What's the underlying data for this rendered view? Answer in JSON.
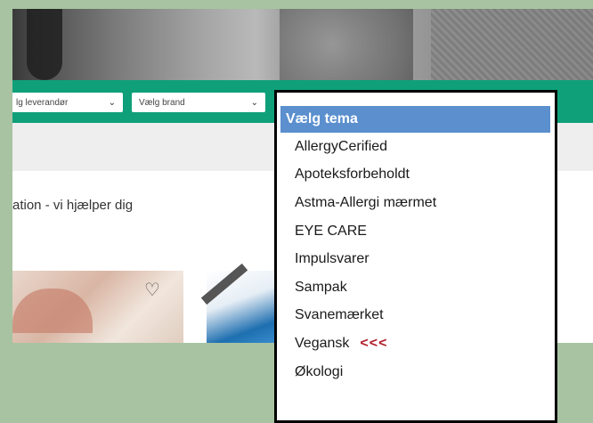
{
  "filters": {
    "supplier_label": "lg leverandør",
    "brand_label": "Vælg brand"
  },
  "main": {
    "headline": "ation - vi hjælper dig"
  },
  "dropdown": {
    "header": "Vælg tema",
    "items": [
      "AllergyCerified",
      "Apoteksforbeholdt",
      "Astma-Allergi mærmet",
      "EYE CARE",
      "Impulsvarer",
      "Sampak",
      "Svanemærket",
      "Vegansk",
      "Økologi"
    ],
    "highlight_marker": "<<<"
  },
  "colors": {
    "page_bg": "#a8c3a2",
    "filter_bar": "#0fa07a",
    "dropdown_header": "#5b8fce",
    "marker": "#b01e2a"
  }
}
